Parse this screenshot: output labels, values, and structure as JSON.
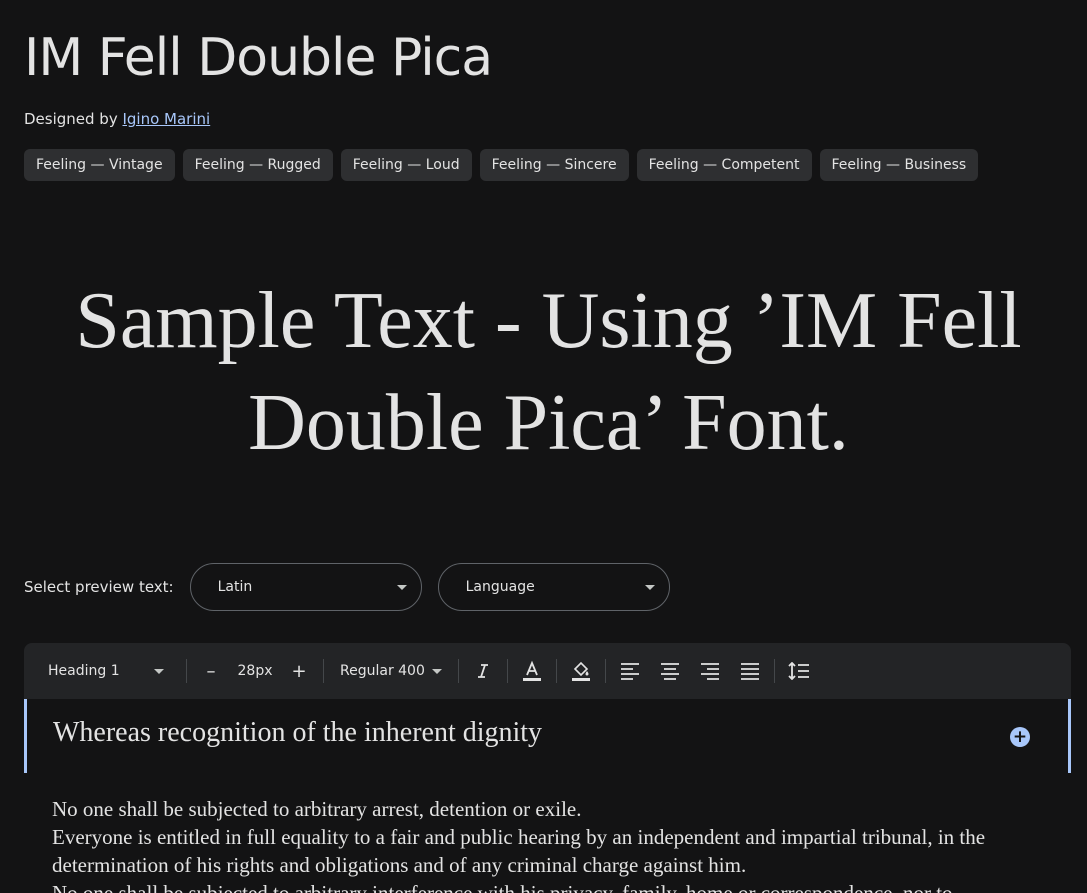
{
  "header": {
    "title": "IM Fell Double Pica",
    "designed_by_prefix": "Designed by ",
    "designer_name": "Igino Marini"
  },
  "tags": [
    "Feeling — Vintage",
    "Feeling — Rugged",
    "Feeling — Loud",
    "Feeling — Sincere",
    "Feeling — Competent",
    "Feeling — Business"
  ],
  "sample_text": "Sample Text - Using ’IM Fell Double Pica’ Font.",
  "preview": {
    "label": "Select preview text:",
    "script_value": "Latin",
    "language_value": "Language"
  },
  "toolbar": {
    "style_value": "Heading 1",
    "decrease_label": "–",
    "size_value": "28px",
    "increase_label": "+",
    "weight_value": "Regular 400"
  },
  "editor": {
    "heading": "Whereas recognition of the inherent dignity",
    "paragraphs": [
      "No one shall be subjected to arbitrary arrest, detention or exile.",
      "Everyone is entitled in full equality to a fair and public hearing by an independent and impartial tribunal, in the determination of his rights and obligations and of any criminal charge against him.",
      "No one shall be subjected to arbitrary interference with his privacy, family, home or correspondence, nor to"
    ]
  },
  "colors": {
    "background": "#131314",
    "link": "#a8c7fa",
    "accent": "#a8c7fa"
  }
}
